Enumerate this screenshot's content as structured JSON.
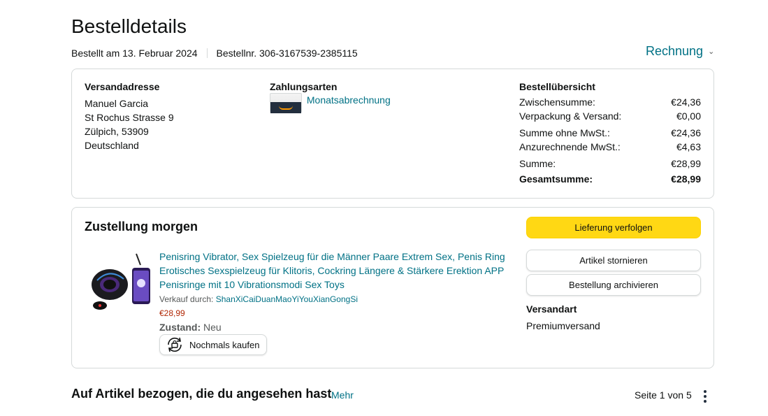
{
  "header": {
    "title": "Bestelldetails",
    "ordered_on": "Bestellt am 13. Februar 2024",
    "order_number": "Bestellnr. 306-3167539-2385115",
    "invoice_label": "Rechnung"
  },
  "shipping_address": {
    "title": "Versandadresse",
    "lines": [
      "Manuel Garcia",
      "St Rochus Strasse 9",
      "Zülpich, 53909",
      "Deutschland"
    ]
  },
  "payment": {
    "title": "Zahlungsarten",
    "method": "Monatsabrechnung"
  },
  "summary": {
    "title": "Bestellübersicht",
    "rows": [
      {
        "label": "Zwischensumme:",
        "value": "€24,36"
      },
      {
        "label": "Verpackung & Versand:",
        "value": "€0,00"
      },
      {
        "label": "Summe ohne MwSt.:",
        "value": "€24,36"
      },
      {
        "label": "Anzurechnende MwSt.:",
        "value": "€4,63"
      },
      {
        "label": "Summe:",
        "value": "€28,99"
      },
      {
        "label": "Gesamtsumme:",
        "value": "€28,99"
      }
    ]
  },
  "delivery": {
    "title": "Zustellung morgen",
    "product_title": "Penisring Vibrator, Sex Spielzeug für die Männer Paare Extrem Sex, Penis Ring Erotisches Sexspielzeug für Klitoris, Cockring Längere & Stärkere Erektion APP Penisringe mit 10 Vibrationsmodi Sex Toys",
    "seller_prefix": "Verkauf durch:",
    "seller_name": "ShanXiCaiDuanMaoYiYouXianGongSi",
    "price": "€28,99",
    "condition_label": "Zustand:",
    "condition_value": "Neu",
    "rebuy_label": "Nochmals kaufen",
    "track_label": "Lieferung verfolgen",
    "cancel_label": "Artikel stornieren",
    "archive_label": "Bestellung archivieren",
    "ship_method_label": "Versandart",
    "ship_method_value": "Premiumversand"
  },
  "related": {
    "title": "Auf Artikel bezogen, die du angesehen hast",
    "more_label": "Mehr",
    "page_info": "Seite 1 von 5"
  },
  "colors": {
    "link": "#007185",
    "button_yellow": "#ffd814",
    "price_red": "#b12704",
    "border": "#d5d9d9"
  }
}
